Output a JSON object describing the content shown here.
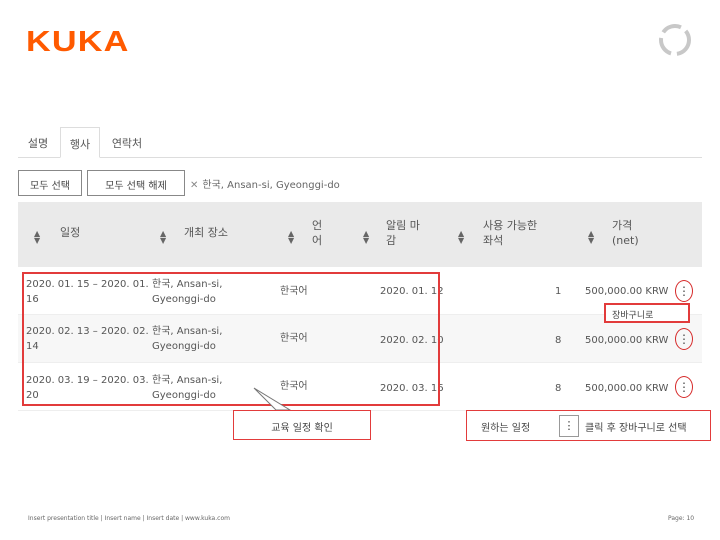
{
  "brand": {
    "logo_text": "KUKA",
    "logo_color": "#ff5a00"
  },
  "tabs": [
    {
      "label": "설명"
    },
    {
      "label": "행사"
    },
    {
      "label": "연락처"
    }
  ],
  "filters": {
    "select_all_label": "모두 선택",
    "clear_all_label": "모두 선택 해제",
    "active_filter": "한국, Ansan-si, Gyeonggi-do",
    "remove_icon": "x-icon"
  },
  "table": {
    "headers": {
      "schedule": "일정",
      "location": "개최 장소",
      "language_line1": "언",
      "language_line2": "어",
      "notice_line1": "알림 마",
      "notice_line2": "감",
      "seats_line1": "사용 가능한",
      "seats_line2": "좌석",
      "price_line1": "가격",
      "price_line2": "(net)"
    },
    "rows": [
      {
        "date_line1": "2020. 01. 15 – 2020. 01.",
        "date_line2": "16",
        "loc_line1": "한국, Ansan-si,",
        "loc_line2": "Gyeonggi-do",
        "language": "한국어",
        "deadline": "2020. 01. 12",
        "seats": "1",
        "price": "500,000.00 KRW"
      },
      {
        "date_line1": "2020. 02. 13 – 2020. 02.",
        "date_line2": "14",
        "loc_line1": "한국, Ansan-si,",
        "loc_line2": "Gyeonggi-do",
        "language": "한국어",
        "deadline": "2020. 02. 10",
        "seats": "8",
        "price": "500,000.00 KRW"
      },
      {
        "date_line1": "2020. 03. 19 – 2020. 03.",
        "date_line2": "20",
        "loc_line1": "한국, Ansan-si,",
        "loc_line2": "Gyeonggi-do",
        "language": "한국어",
        "deadline": "2020. 03. 16",
        "seats": "8",
        "price": "500,000.00 KRW"
      }
    ],
    "row_menu": "⋮",
    "dropdown_item": "장바구니로"
  },
  "annotations": {
    "left_callout": "교육 일정 확인",
    "right_callout_before": "원하는 일정",
    "right_callout_after": "클릭 후 장바구니로 선택",
    "highlight_color": "#e23b3b"
  },
  "footer": {
    "left": "Insert presentation title | Insert name | Insert date | www.kuka.com",
    "right": "Page: 10"
  }
}
